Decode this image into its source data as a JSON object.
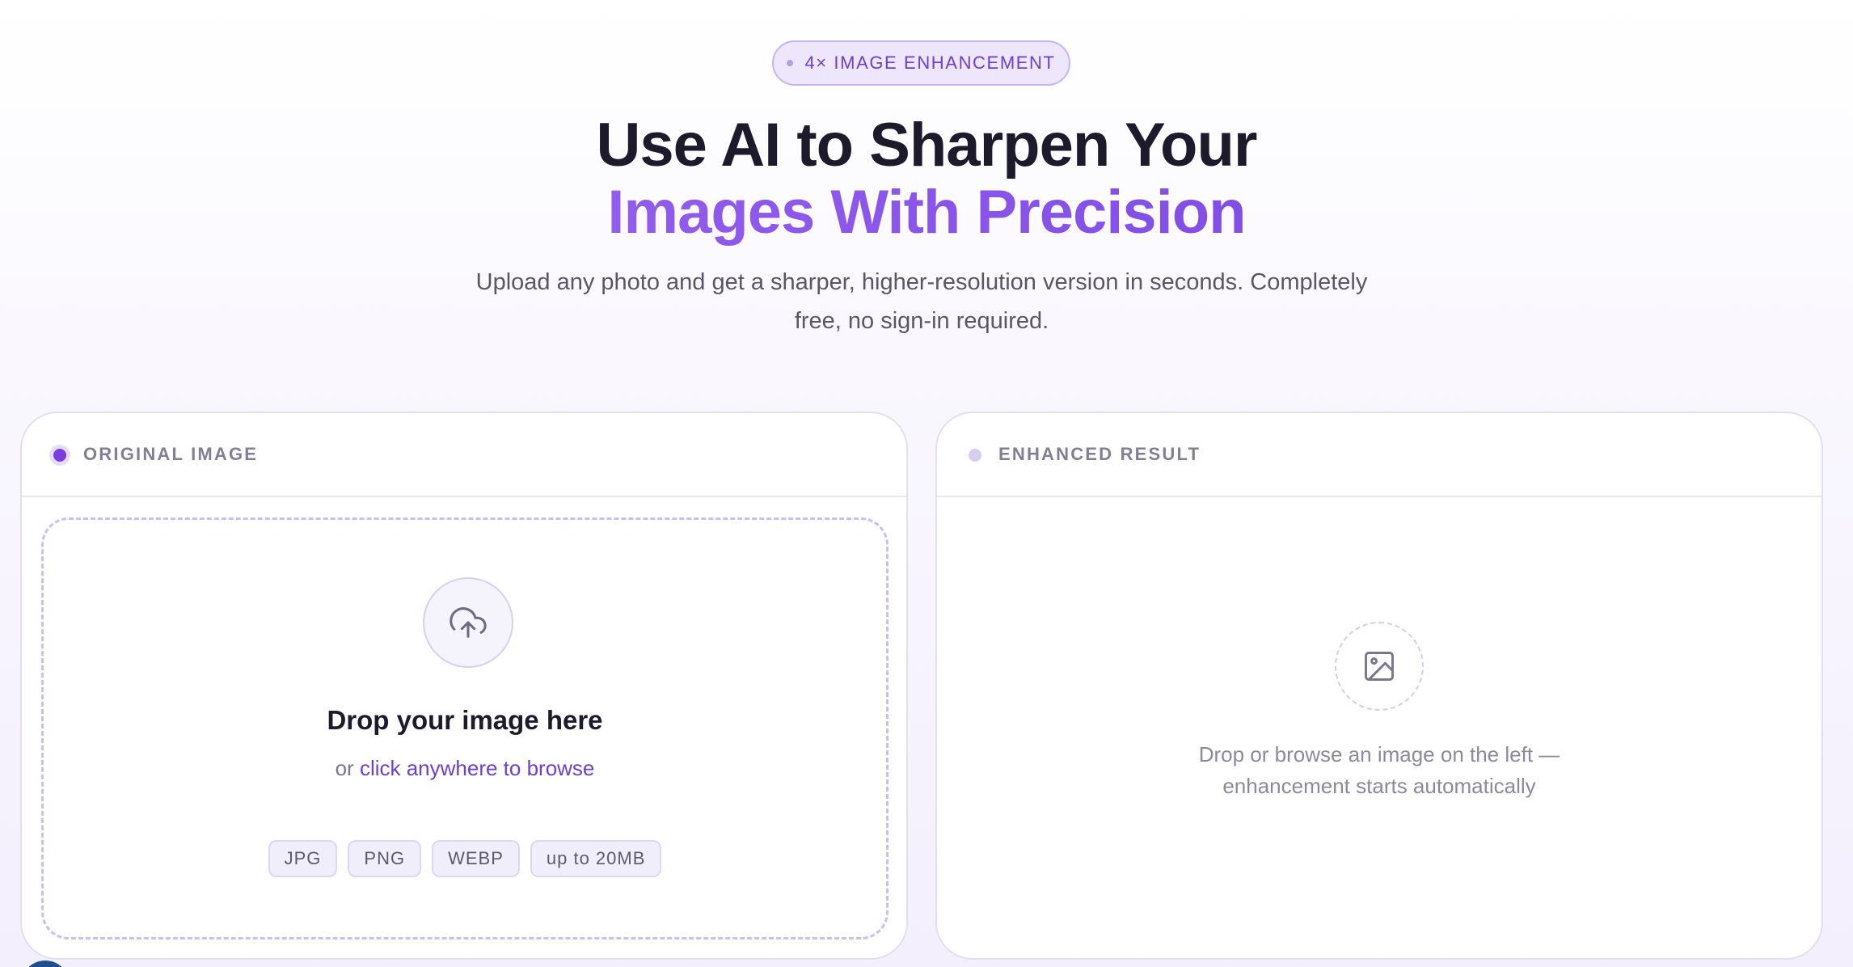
{
  "hero": {
    "badge": "4× IMAGE ENHANCEMENT",
    "headline_line1": "Use AI to Sharpen Your",
    "headline_line2": "Images With Precision",
    "subtitle": "Upload any photo and get a sharper, higher-resolution version in seconds. Completely free, no sign-in required."
  },
  "original_panel": {
    "title": "ORIGINAL IMAGE",
    "upload_icon": "cloud-upload-icon",
    "drop_title": "Drop your image here",
    "drop_prefix": "or",
    "drop_link": "click anywhere to browse",
    "formats": [
      "JPG",
      "PNG",
      "WEBP",
      "up to 20MB"
    ]
  },
  "result_panel": {
    "title": "ENHANCED RESULT",
    "placeholder_icon": "image-icon",
    "message": "Drop or browse an image on the left — enhancement starts automatically"
  },
  "colors": {
    "accent": "#6d3fd1",
    "headline_gradient_start": "#a16bef",
    "headline_gradient_end": "#7440df",
    "text_dark": "#1d1a2c",
    "text_muted": "#7a768a",
    "chip_bg": "#f1eefb"
  }
}
